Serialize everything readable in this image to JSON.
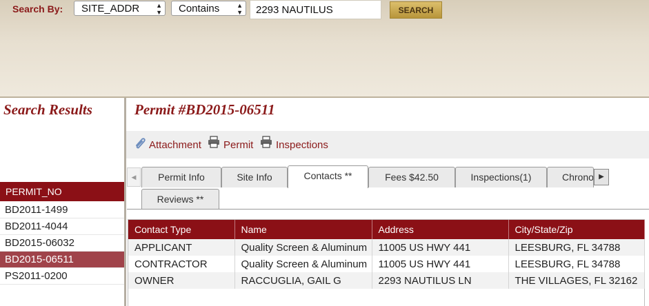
{
  "search": {
    "label": "Search By:",
    "field_select": "SITE_ADDR",
    "operator_select": "Contains",
    "query_value": "2293 NAUTILUS",
    "button_label": "SEARCH"
  },
  "results": {
    "title": "Search Results",
    "column_header": "PERMIT_NO",
    "items": [
      "BD2011-1499",
      "BD2011-4044",
      "BD2015-06032",
      "BD2015-06511",
      "PS2011-0200"
    ],
    "selected": "BD2015-06511"
  },
  "permit": {
    "title": "Permit #BD2015-06511",
    "links": {
      "attachment": "Attachment",
      "permit": "Permit",
      "inspections": "Inspections"
    }
  },
  "tabs": {
    "permit_info": "Permit Info",
    "site_info": "Site Info",
    "contacts": "Contacts **",
    "fees": "Fees $42.50",
    "inspections": "Inspections(1)",
    "chrono": "Chrono",
    "reviews": "Reviews **",
    "active": "Contacts **"
  },
  "contacts": {
    "headers": [
      "Contact Type",
      "Name",
      "Address",
      "City/State/Zip"
    ],
    "rows": [
      [
        "APPLICANT",
        "Quality Screen & Aluminum",
        "11005 US HWY 441",
        "LEESBURG, FL 34788"
      ],
      [
        "CONTRACTOR",
        "Quality Screen & Aluminum",
        "11005 US HWY 441",
        "LEESBURG, FL 34788"
      ],
      [
        "OWNER",
        "RACCUGLIA, GAIL G",
        "2293 NAUTILUS LN",
        "THE VILLAGES, FL 32162"
      ]
    ]
  },
  "colors": {
    "brand_red": "#8b1016",
    "selected_row": "#a0434a",
    "header_band": "#e7dfd0",
    "button_gold": "#c9a752"
  },
  "icons": [
    "paperclip-icon",
    "printer-icon",
    "chevron-right-icon",
    "chevron-left-icon",
    "select-arrows-icon"
  ]
}
